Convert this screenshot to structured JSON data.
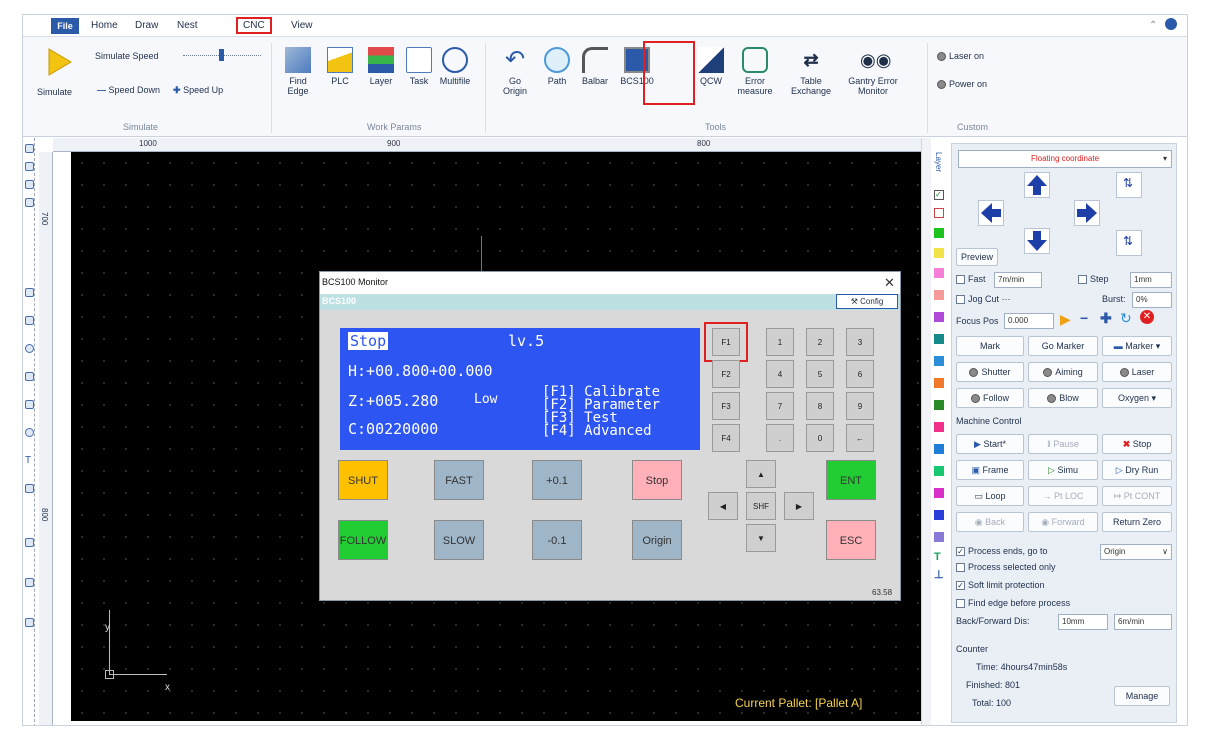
{
  "menubar": {
    "file": "File",
    "items": [
      "Home",
      "Draw",
      "Nest",
      "CNC",
      "View"
    ]
  },
  "ribbon": {
    "simulate": {
      "label": "Simulate",
      "speed_label": "Simulate Speed",
      "speed_down": "Speed Down",
      "speed_up": "Speed Up",
      "group": "Simulate"
    },
    "work_params": {
      "find_edge": "Find\nEdge",
      "plc": "PLC",
      "layer": "Layer",
      "task": "Task",
      "multifile": "Multifile",
      "group": "Work Params"
    },
    "tools": {
      "go_origin": "Go\nOrigin",
      "path": "Path",
      "balbar": "Balbar",
      "bcs100": "BCS100",
      "qcw": "QCW",
      "error_measure": "Error\nmeasure",
      "table_exchange": "Table\nExchange",
      "gantry_error": "Gantry Error\nMonitor",
      "group": "Tools"
    },
    "custom": {
      "laser_on": "Laser on",
      "power_on": "Power on",
      "group": "Custom"
    }
  },
  "rulers": {
    "top": [
      "1000",
      "900",
      "800"
    ],
    "left": [
      "700",
      "800"
    ]
  },
  "canvas": {
    "pallet": "Current Pallet: [Pallet A]",
    "axis_x": "x",
    "axis_y": "y"
  },
  "layers": {
    "label": "Layer"
  },
  "dialog": {
    "title": "BCS100 Monitor",
    "band": "BCS100",
    "config": "Config",
    "footer_value": "63.58",
    "lcd": {
      "status": "Stop",
      "level": "lv.5",
      "h": "H:+00.800+00.000",
      "z": "Z:+005.280",
      "z_mode": "Low",
      "c": "C:00220000",
      "menu": [
        "[F1] Calibrate",
        "[F2] Parameter",
        "[F3] Test",
        "[F4] Advanced"
      ]
    },
    "buttons": {
      "shut": "SHUT",
      "fast": "FAST",
      "plus": "+0.1",
      "stop": "Stop",
      "follow": "FOLLOW",
      "slow": "SLOW",
      "minus": "-0.1",
      "origin": "Origin",
      "ent": "ENT",
      "esc": "ESC",
      "shf": "SHF"
    },
    "fkeys": [
      "F1",
      "F2",
      "F3",
      "F4"
    ],
    "keypad": [
      "1",
      "2",
      "3",
      "4",
      "5",
      "6",
      "7",
      "8",
      "9",
      ".",
      "0",
      "←"
    ],
    "colors": {
      "lcd": "#2c55f2",
      "shut": "#ffc000",
      "follow": "#22cc33",
      "ent": "#22cc33",
      "stop": "#ffb0b8",
      "esc": "#ffb0b8",
      "neutral": "#9fb6c8"
    }
  },
  "panel": {
    "coordinate": "Floating coordinate",
    "preview": "Preview",
    "fast": "Fast",
    "fast_value": "7m/min",
    "step": "Step",
    "step_value": "1mm",
    "jog_cut": "Jog Cut",
    "burst": "Burst:",
    "burst_value": "0%",
    "focus_pos": "Focus Pos",
    "focus_value": "0.000",
    "mark": "Mark",
    "go_marker": "Go Marker",
    "marker": "Marker",
    "shutter": "Shutter",
    "aiming": "Aiming",
    "laser": "Laser",
    "follow": "Follow",
    "blow": "Blow",
    "oxygen": "Oxygen",
    "machine_control": "Machine Control",
    "start": "Start*",
    "pause": "Pause",
    "stop": "Stop",
    "frame": "Frame",
    "simu": "Simu",
    "dry_run": "Dry Run",
    "loop": "Loop",
    "pt_loc": "Pt LOC",
    "pt_cont": "Pt CONT",
    "back": "Back",
    "forward": "Forward",
    "return_zero": "Return Zero",
    "process_ends": "Process ends, go to",
    "process_ends_value": "Origin",
    "process_selected": "Process selected only",
    "soft_limit": "Soft limit protection",
    "find_edge": "Find edge before process",
    "back_forward_dis": "Back/Forward Dis:",
    "bf_value": "10mm",
    "bf_speed": "6m/min",
    "counter": "Counter",
    "time": "Time: 4hours47min58s",
    "finished": "Finished: 801",
    "total": "Total: 100",
    "manage": "Manage"
  }
}
